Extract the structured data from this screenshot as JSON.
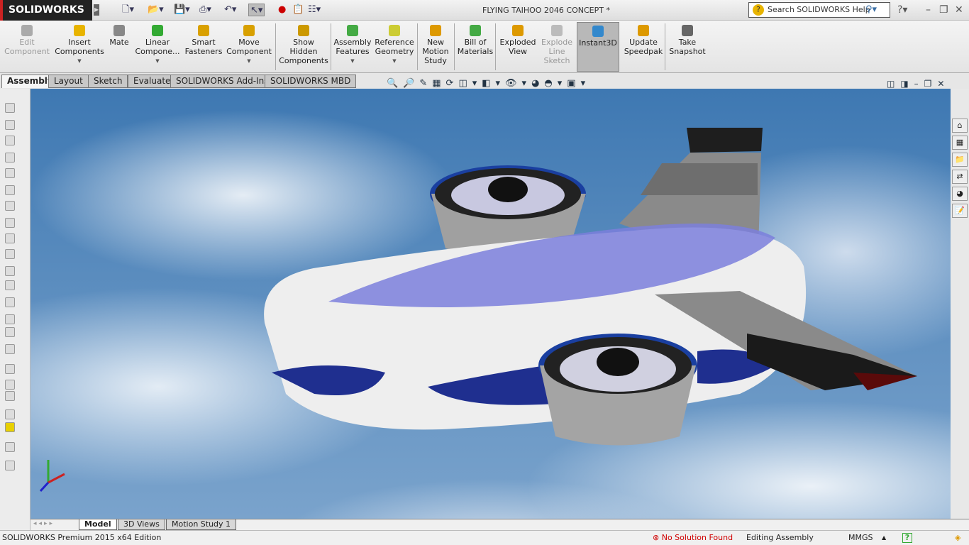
{
  "app": {
    "logo": "SOLIDWORKS",
    "doc_title": "FLYING TAIHOO 2046 CONCEPT *"
  },
  "search": {
    "placeholder": "Search SOLIDWORKS Help"
  },
  "ribbon": [
    {
      "label": "Edit Component",
      "disabled": true,
      "icon": "edit-component-icon",
      "color": "#aaa"
    },
    {
      "label": "Insert Components",
      "dropdown": true,
      "icon": "insert-components-icon",
      "color": "#e8b400"
    },
    {
      "label": "Mate",
      "icon": "mate-icon",
      "color": "#888"
    },
    {
      "label": "Linear Compone...",
      "dropdown": true,
      "icon": "linear-pattern-icon",
      "color": "#3a3"
    },
    {
      "label": "Smart Fasteners",
      "icon": "smart-fasteners-icon",
      "color": "#d9a000"
    },
    {
      "label": "Move Component",
      "dropdown": true,
      "icon": "move-component-icon",
      "color": "#d8a000"
    },
    {
      "label": "Show Hidden Components",
      "icon": "show-hidden-icon",
      "color": "#c90"
    },
    {
      "label": "Assembly Features",
      "dropdown": true,
      "icon": "assembly-features-icon",
      "color": "#4a4"
    },
    {
      "label": "Reference Geometry",
      "dropdown": true,
      "icon": "reference-geometry-icon",
      "color": "#cc3"
    },
    {
      "label": "New Motion Study",
      "icon": "motion-study-icon",
      "color": "#d90"
    },
    {
      "label": "Bill of Materials",
      "icon": "bom-icon",
      "color": "#4a4"
    },
    {
      "label": "Exploded View",
      "icon": "exploded-view-icon",
      "color": "#d90"
    },
    {
      "label": "Explode Line Sketch",
      "disabled": true,
      "icon": "explode-line-icon",
      "color": "#bbb"
    },
    {
      "label": "Instant3D",
      "active": true,
      "icon": "instant3d-icon",
      "color": "#38c"
    },
    {
      "label": "Update Speedpak",
      "icon": "speedpak-icon",
      "color": "#d90"
    },
    {
      "label": "Take Snapshot",
      "icon": "snapshot-icon",
      "color": "#666"
    }
  ],
  "tabs": [
    "Assembly",
    "Layout",
    "Sketch",
    "Evaluate",
    "SOLIDWORKS Add-Ins",
    "SOLIDWORKS MBD"
  ],
  "bottom_tabs": [
    "Model",
    "3D Views",
    "Motion Study 1"
  ],
  "status": {
    "edition": "SOLIDWORKS Premium 2015 x64 Edition",
    "solution": "No Solution Found",
    "mode": "Editing Assembly",
    "units": "MMGS"
  },
  "colors": {
    "error": "#d00000"
  }
}
